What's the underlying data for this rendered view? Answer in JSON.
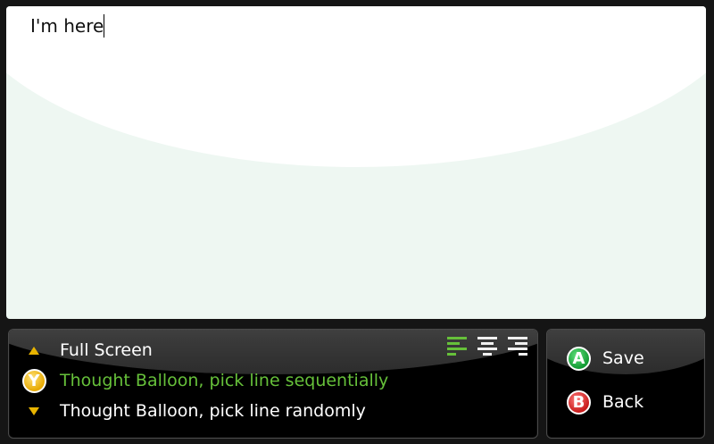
{
  "editor": {
    "text": "I'm here"
  },
  "modes": [
    {
      "label": "Full Screen",
      "key": "up",
      "selected": false
    },
    {
      "label": "Thought Balloon, pick line sequentially",
      "key": "Y",
      "selected": true
    },
    {
      "label": "Thought Balloon, pick line randomly",
      "key": "down",
      "selected": false
    }
  ],
  "alignment": {
    "options": [
      "align-left",
      "align-center",
      "align-right"
    ],
    "active": "align-left"
  },
  "actions": {
    "save": {
      "key": "A",
      "label": "Save"
    },
    "back": {
      "key": "B",
      "label": "Back"
    }
  },
  "colors": {
    "selected_text": "#66c03a",
    "arrow": "#e8b400",
    "button_a": "#139a34",
    "button_b": "#c81b1b",
    "button_y": "#e7a900"
  }
}
